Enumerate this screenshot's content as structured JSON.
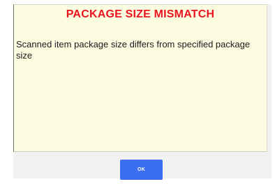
{
  "dialog": {
    "title": "PACKAGE SIZE MISMATCH",
    "message": "Scanned item package size differs from specified package size",
    "ok_label": "OK"
  },
  "colors": {
    "title_red": "#e9141d",
    "panel_yellow": "#fdfde1",
    "button_blue": "#3b6ef0"
  }
}
